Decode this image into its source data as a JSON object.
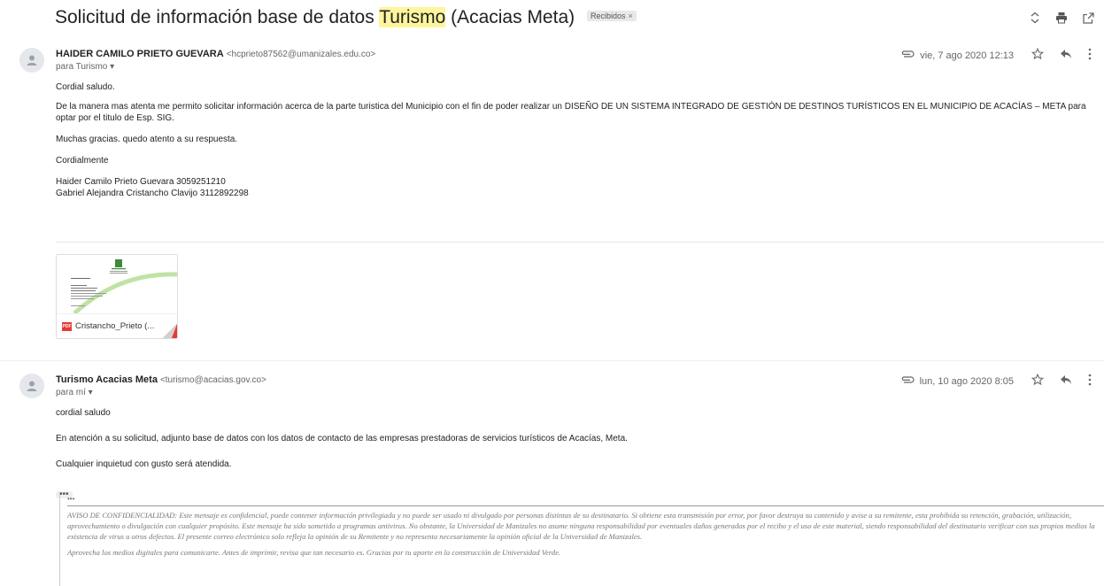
{
  "thread": {
    "subject_before": "Solicitud de información base de datos ",
    "subject_highlight": "Turismo",
    "subject_after": " (Acacias Meta)",
    "label": "Recibidos",
    "label_close": "×"
  },
  "top_icons": [
    "expand-collapse-icon",
    "print-icon",
    "open-new-window-icon"
  ],
  "messages": [
    {
      "sender_name": "HAIDER CAMILO PRIETO GUEVARA",
      "sender_email": "<hcprieto87562@umanizales.edu.co>",
      "to": "para Turismo ▾",
      "date": "vie, 7 ago 2020 12:13",
      "body": [
        "Cordial saludo.",
        "De la manera mas atenta me permito solicitar información acerca de la parte turistica del Municipio con el fin de poder realizar  un DISEÑO DE UN SISTEMA INTEGRADO DE GESTIÓN DE DESTINOS TURÍSTICOS EN EL MUNICIPIO DE ACACÍAS – META para optar por el titulo de Esp. SIG.",
        "Muchas gracias. quedo atento a su respuesta.",
        "Cordialmente",
        "Haider Camilo Prieto Guevara  3059251210",
        "Gabriel Alejandra Cristancho Clavijo 3112892298"
      ],
      "attachment": {
        "name": "Cristancho_Prieto (...",
        "type": "PDF"
      }
    },
    {
      "sender_name": "Turismo Acacias Meta",
      "sender_email": "<turismo@acacias.gov.co>",
      "to": "para mí ▾",
      "date": "lun, 10 ago 2020 8:05",
      "body": [
        "cordial saludo",
        "En atención a su solicitud, adjunto base de datos con los datos de contacto de las empresas prestadoras de servicios turísticos de Acacías, Meta.",
        "Cualquier inquietud con gusto será atendida."
      ],
      "quoted_toggle": "•••",
      "inner_toggle": "•••",
      "legal": [
        "AVISO DE CONFIDENCIALIDAD: Este mensaje es confidencial, puede contener información privilegiada y no puede ser usado ni divulgado por personas distintas de su destinatario.  Si obtiene esta transmisión por error, por favor destruya su contenido y avise a su remitente, esta prohibida su retención, grabación, utilización, aprovechamiento o divulgación con cualquier propósito.  Este mensaje ha sido sometido a programas antivirus.  No obstante, la Universidad de Manizales no asume ninguna responsabilidad por eventuales daños generados por el recibo y el uso de este material, siendo responsabilidad del destinatario verificar con sus propios medios la existencia de virus u otros defectos.  El presente correo electrónico solo refleja la opinión de su Remitente y no representa necesariamente la opinión oficial de la Universidad de Manizales.",
        "Aprovecha los medios digitales para comunicarte.  Antes de imprimir, revisa que tan necesario es.  Gracias por tu aporte en la construcción de Universidad Verde."
      ]
    }
  ],
  "colors": {
    "highlight": "#fff59d",
    "pdf_red": "#e53935",
    "meta_gray": "#666666"
  }
}
